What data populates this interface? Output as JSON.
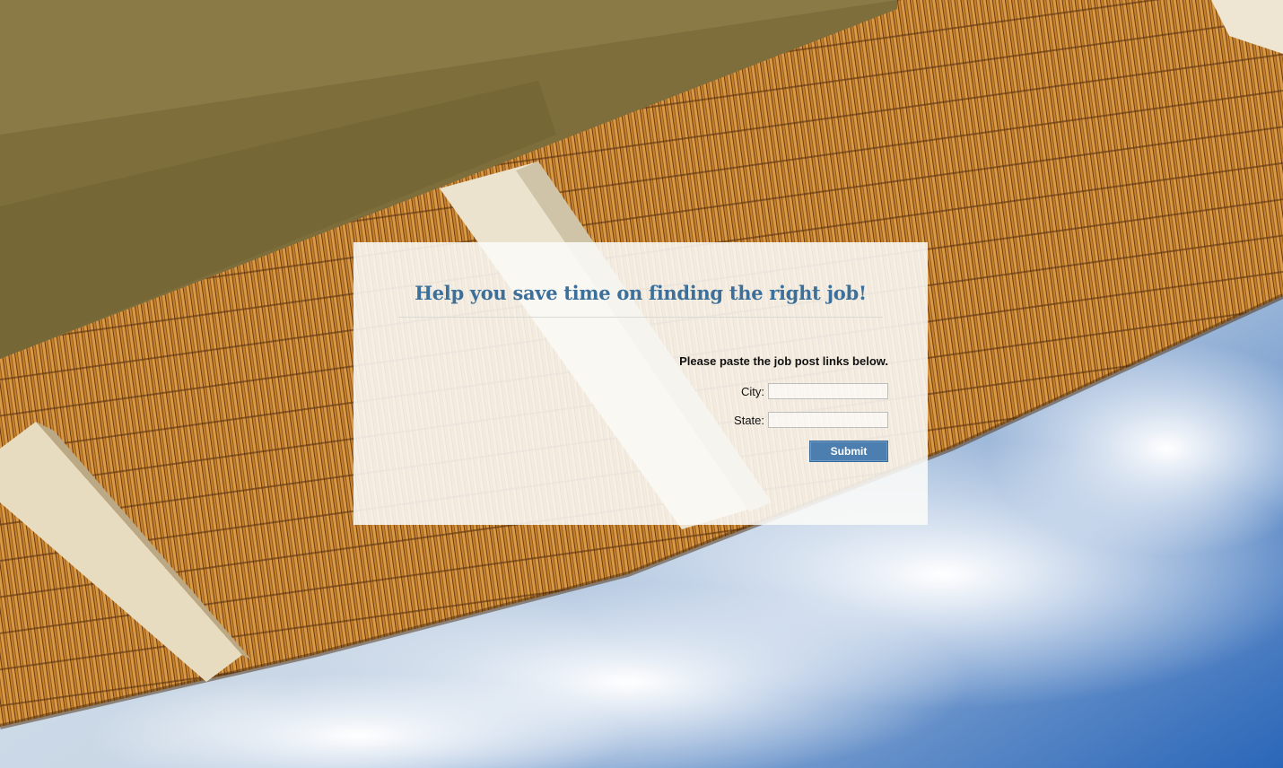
{
  "page": {
    "heading": "Help you save time on finding the right job!",
    "instructions": "Please paste the job post links below."
  },
  "form": {
    "city_label": "City:",
    "city_value": "",
    "state_label": "State:",
    "state_value": "",
    "submit_label": "Submit"
  },
  "colors": {
    "heading": "#3c6f9a",
    "submit_button": "#4c7fb0",
    "panel_background": "#fafaf8"
  }
}
